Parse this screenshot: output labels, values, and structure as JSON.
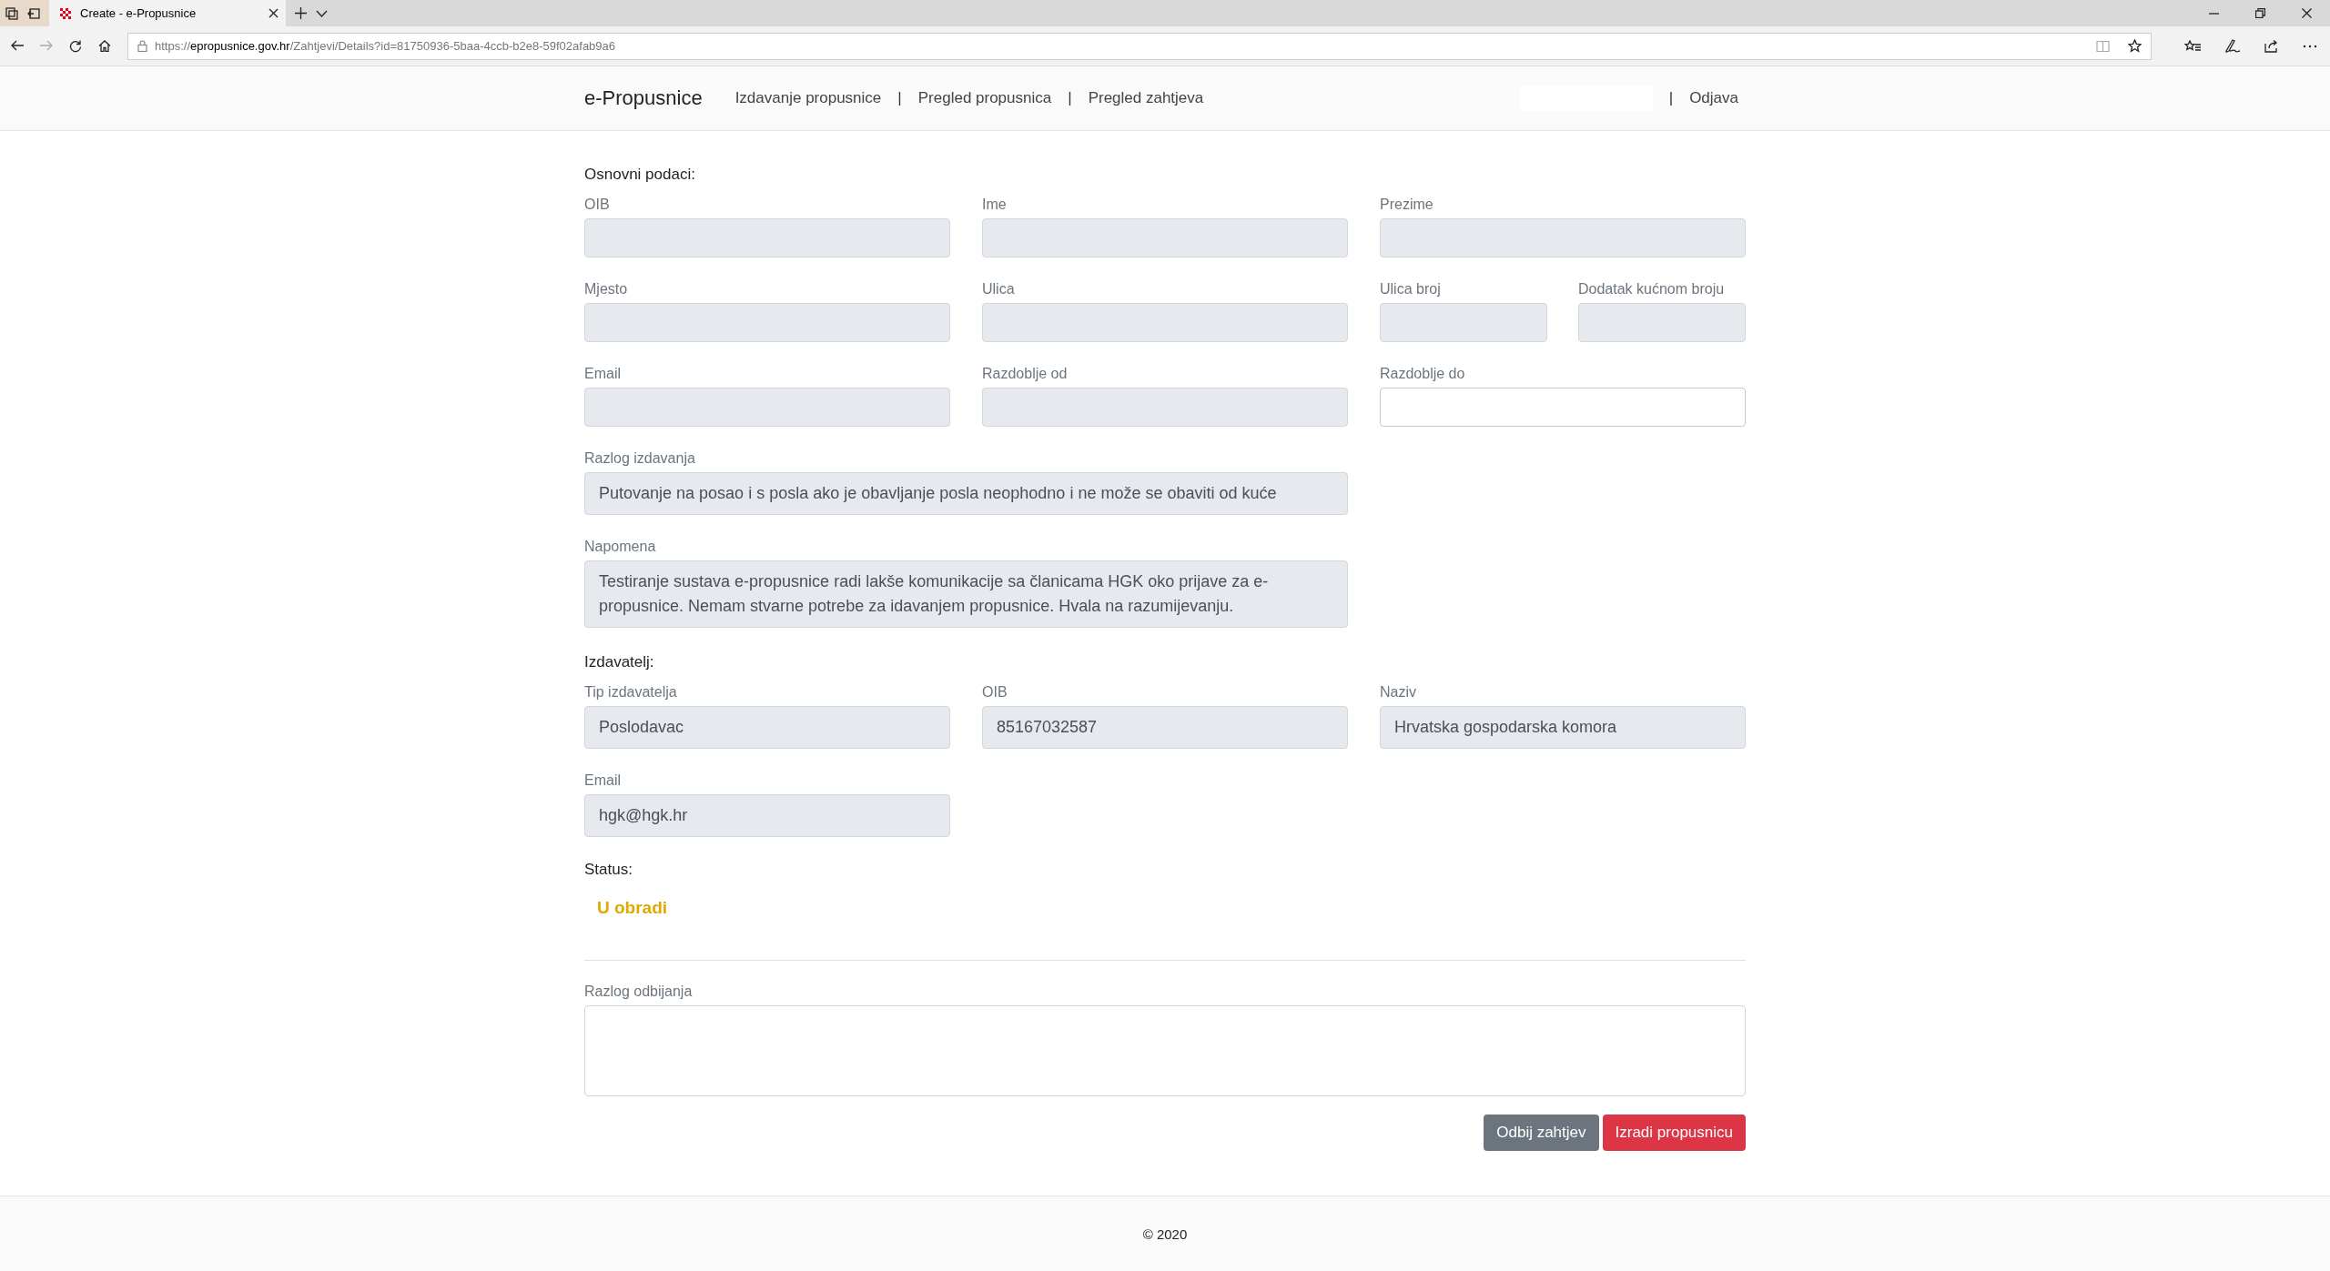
{
  "browser": {
    "tabs": [
      {
        "title": "Create - e-Propusnice",
        "selected": true
      }
    ],
    "nav_buttons": [
      {
        "kind": "back",
        "disabled": false
      },
      {
        "kind": "forward",
        "disabled": true
      },
      {
        "kind": "refresh",
        "disabled": false
      },
      {
        "kind": "home",
        "disabled": false
      }
    ],
    "address": {
      "scheme": "https://",
      "host": "epropusnice.gov.hr",
      "path": "/Zahtjevi/Details?id=81750936-5baa-4ccb-b2e8-59f02afab9a6"
    }
  },
  "nav": {
    "brand": "e-Propusnice",
    "left": [
      {
        "kind": "link",
        "label": "Izdavanje propusnice"
      },
      {
        "kind": "separator",
        "label": "|"
      },
      {
        "kind": "link",
        "label": "Pregled propusnica"
      },
      {
        "kind": "separator",
        "label": "|"
      },
      {
        "kind": "link",
        "label": "Pregled zahtjeva"
      }
    ],
    "right": [
      {
        "kind": "blank"
      },
      {
        "kind": "separator",
        "label": "|"
      },
      {
        "kind": "link",
        "label": "Odjava"
      }
    ]
  },
  "sections": [
    {
      "title": "Osnovni podaci:",
      "rows": [
        [
          {
            "label": "OIB",
            "disabled": true
          },
          {
            "label": "Ime",
            "disabled": true
          },
          {
            "label": "Prezime",
            "disabled": true
          }
        ],
        [
          {
            "label": "Mjesto",
            "disabled": true
          },
          {
            "label": "Ulica",
            "disabled": true
          },
          {
            "label": "Ulica broj",
            "disabled": true
          },
          {
            "label": "Dodatak kućnom broju",
            "disabled": true
          }
        ],
        [
          {
            "label": "Email",
            "disabled": true
          },
          {
            "label": "Razdoblje od",
            "disabled": true
          },
          {
            "label": "Razdoblje do",
            "disabled": false
          }
        ],
        [
          {
            "label": "Razlog izdavanja",
            "kind": "long",
            "value": "Putovanje na posao i s posla ako je obavljanje posla neophodno i ne može se obaviti od kuće",
            "disabled": true
          }
        ],
        [
          {
            "label": "Napomena",
            "kind": "long",
            "value": "Testiranje sustava e-propusnice radi lakše komunikacije sa članicama HGK oko prijave za e-propusnice. Nemam stvarne potrebe za idavanjem propusnice. Hvala na razumijevanju.",
            "disabled": true
          }
        ]
      ]
    },
    {
      "title": "Izdavatelj:",
      "rows": [
        [
          {
            "label": "Tip izdavatelja",
            "value": "Poslodavac",
            "disabled": true
          },
          {
            "label": "OIB",
            "value": "85167032587",
            "disabled": true
          },
          {
            "label": "Naziv",
            "value": "Hrvatska gospodarska komora",
            "disabled": true
          }
        ],
        [
          {
            "label": "Email",
            "value": "hgk@hgk.hr",
            "disabled": true
          }
        ]
      ]
    }
  ],
  "status": {
    "title": "Status:",
    "value": "U obradi"
  },
  "rejection": {
    "label": "Razlog odbijanja"
  },
  "buttons": [
    {
      "label": "Odbij zahtjev",
      "kind": "secondary"
    },
    {
      "label": "Izradi propusnicu",
      "kind": "danger"
    }
  ],
  "footer": "© 2020"
}
